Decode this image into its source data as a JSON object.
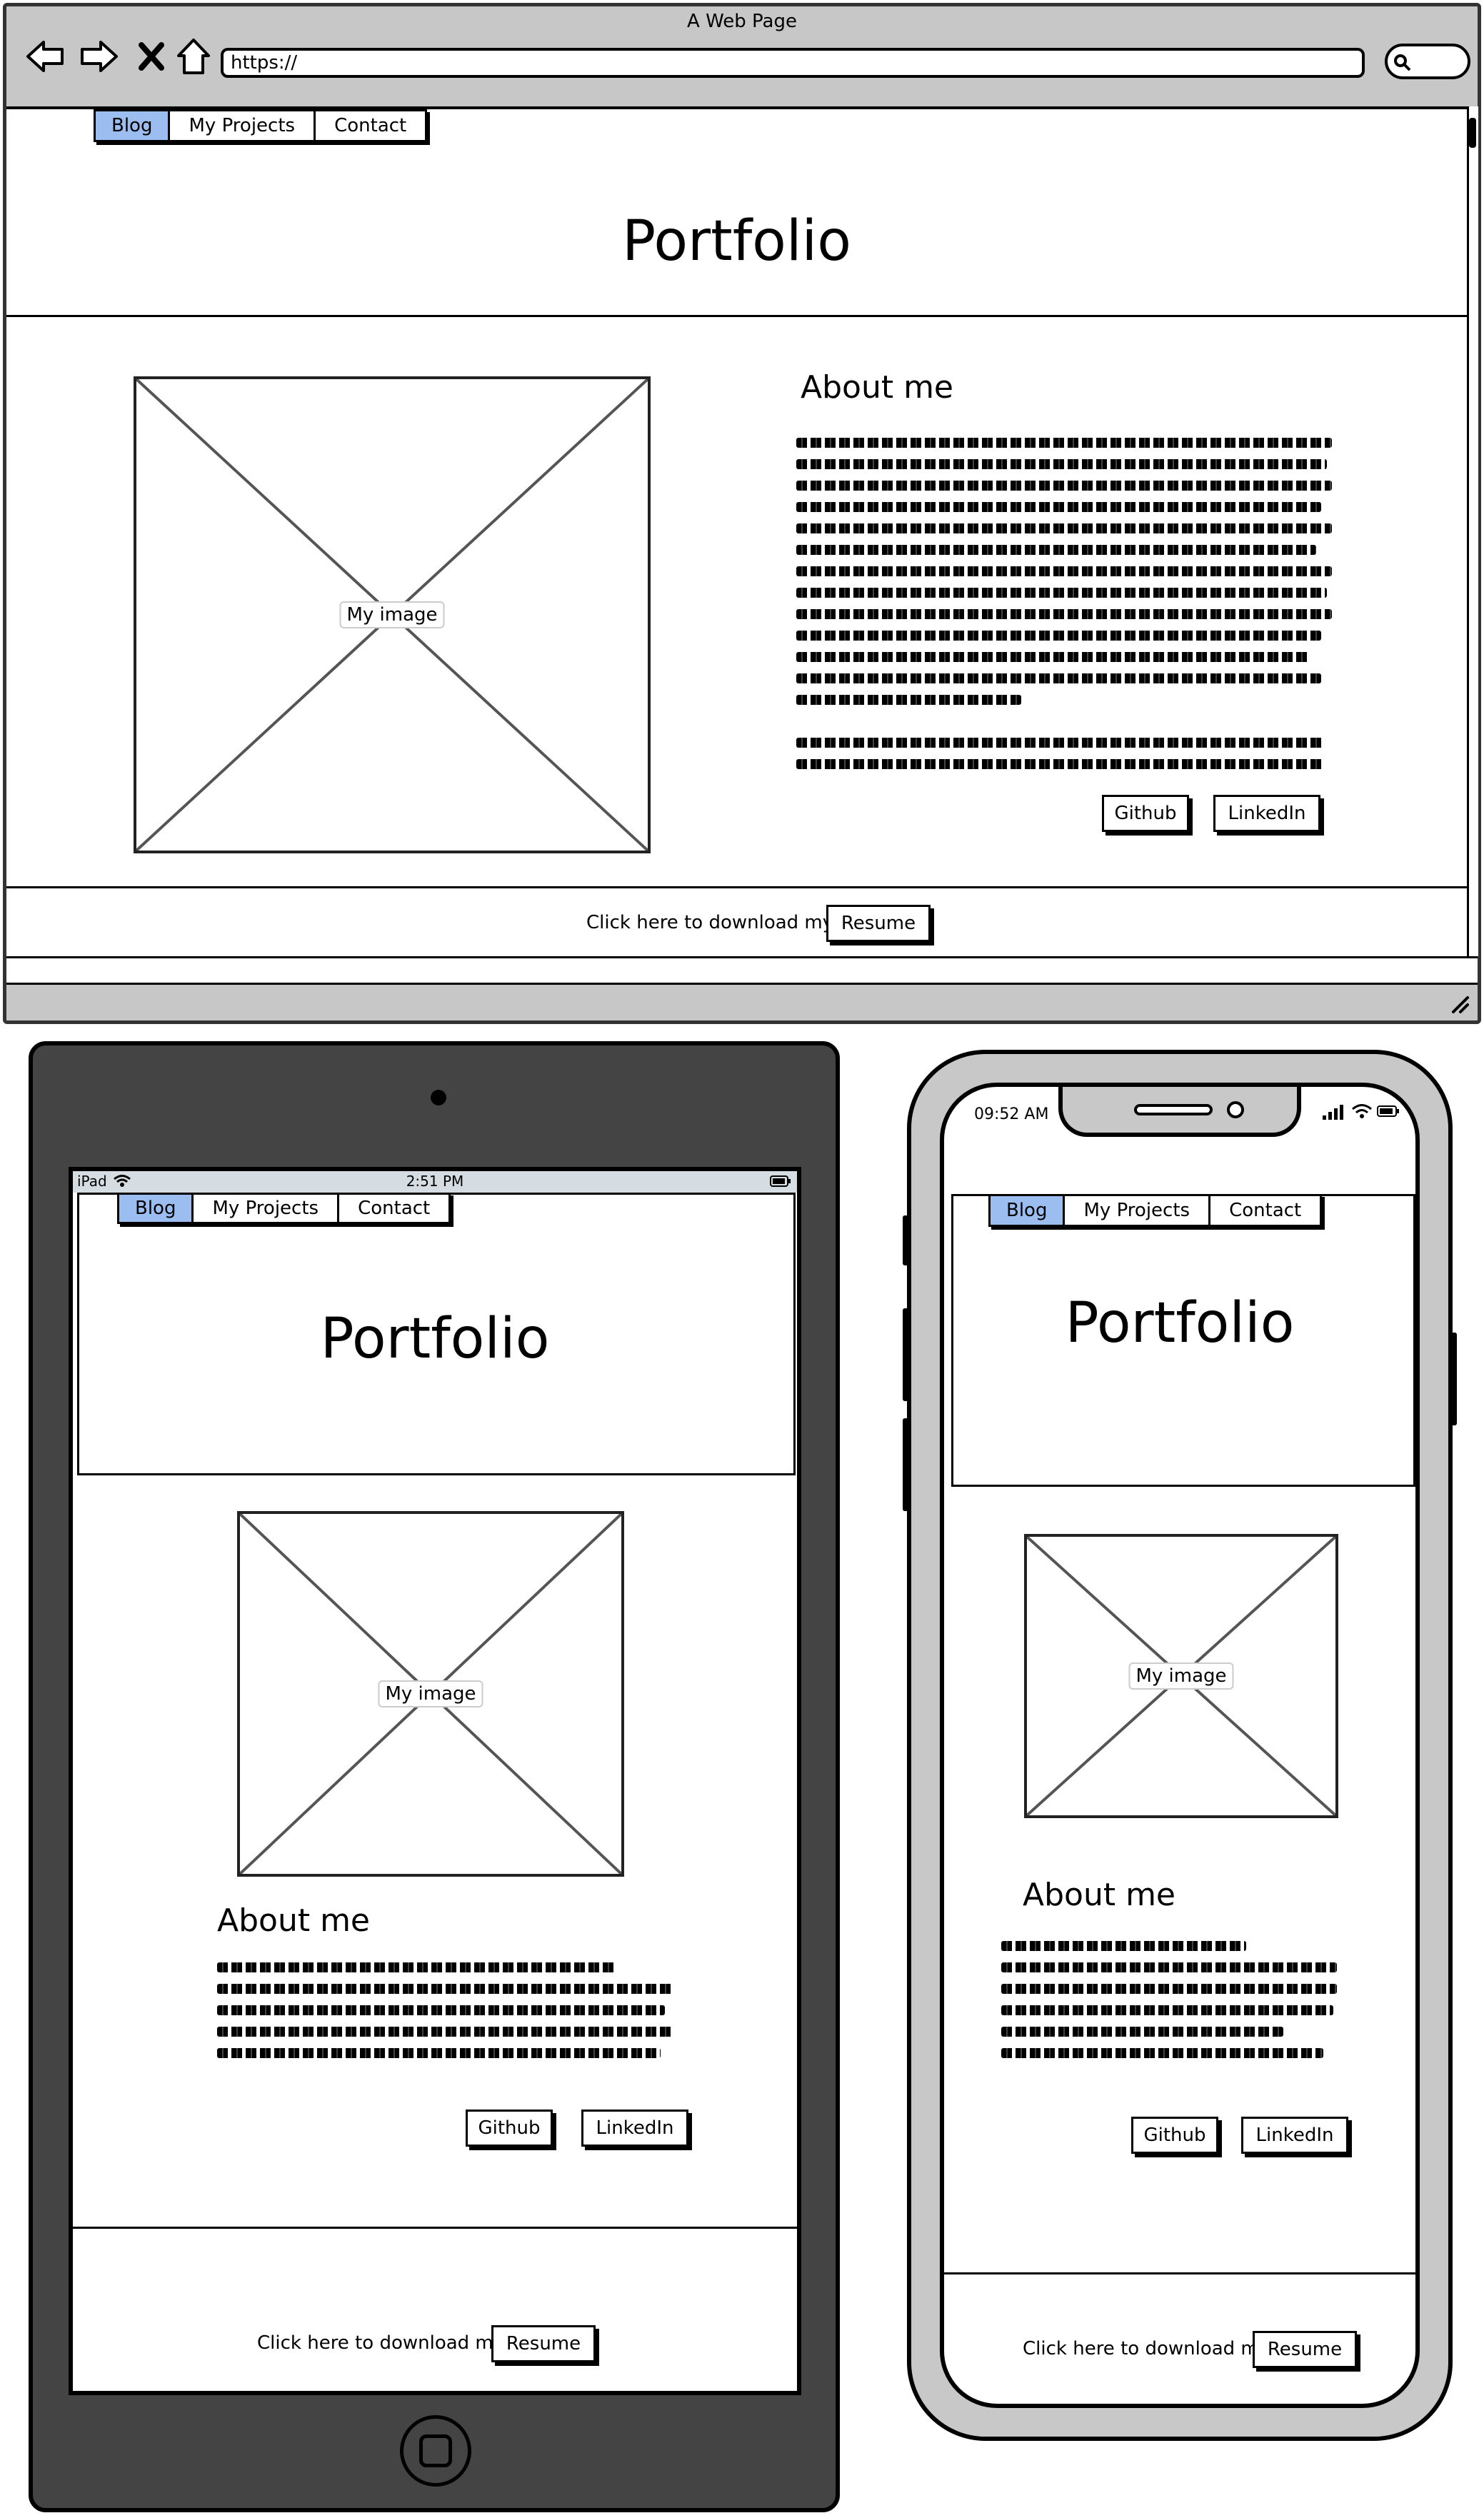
{
  "browser": {
    "window_title": "A Web Page",
    "url": "https://",
    "icons": [
      "back-arrow-icon",
      "forward-arrow-icon",
      "close-x-icon",
      "home-icon",
      "search-icon",
      "resize-grip-icon"
    ]
  },
  "site": {
    "nav": [
      {
        "label": "Blog",
        "active": true
      },
      {
        "label": "My Projects",
        "active": false
      },
      {
        "label": "Contact",
        "active": false
      }
    ],
    "header_title": "Portfolio",
    "image_label": "My image",
    "about_title": "About me",
    "github_label": "Github",
    "linkedin_label": "LinkedIn",
    "footer_text": "Click here to download my",
    "resume_label": "Resume"
  },
  "ipad": {
    "status_device": "iPad",
    "status_time": "2:51 PM"
  },
  "iphone": {
    "status_time": "09:52 AM"
  },
  "colors": {
    "active_tab": "#9cbdf0",
    "browser_chrome": "#c7c7c7",
    "ipad_body": "#444444",
    "iphone_body": "#c8c8c8"
  }
}
